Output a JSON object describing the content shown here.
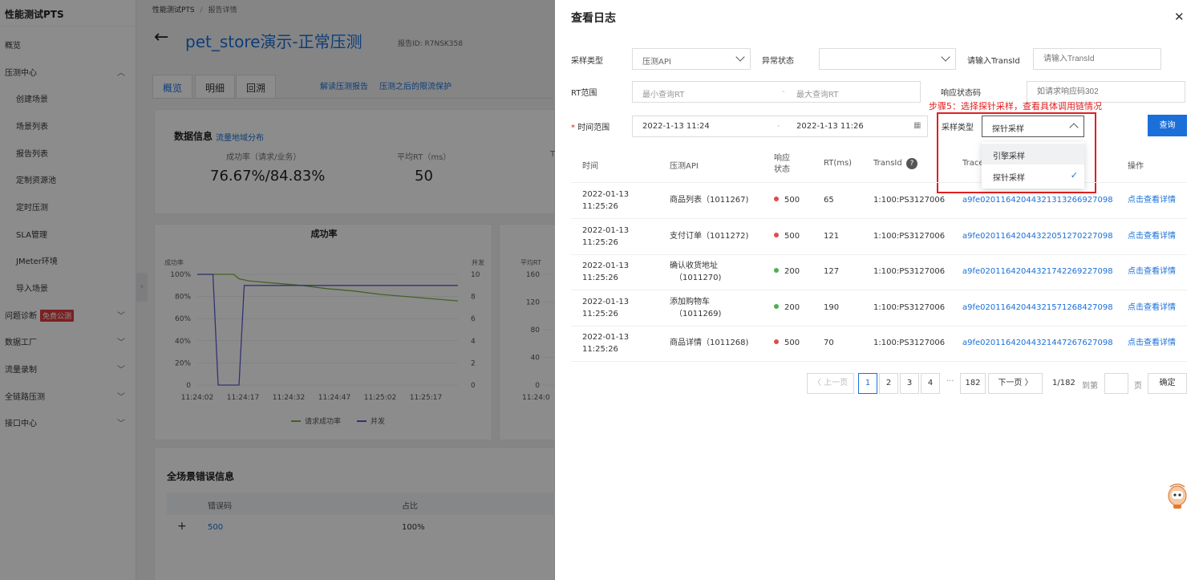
{
  "sidebar": {
    "brand": "性能测试PTS",
    "items": [
      {
        "label": "概览",
        "indent": false,
        "chev": ""
      },
      {
        "label": "压测中心",
        "indent": false,
        "chev": "︿"
      },
      {
        "label": "创建场景",
        "indent": true,
        "chev": ""
      },
      {
        "label": "场景列表",
        "indent": true,
        "chev": ""
      },
      {
        "label": "报告列表",
        "indent": true,
        "chev": ""
      },
      {
        "label": "定制资源池",
        "indent": true,
        "chev": ""
      },
      {
        "label": "定时压测",
        "indent": true,
        "chev": ""
      },
      {
        "label": "SLA管理",
        "indent": true,
        "chev": ""
      },
      {
        "label": "JMeter环境",
        "indent": true,
        "chev": ""
      },
      {
        "label": "导入场景",
        "indent": true,
        "chev": ""
      },
      {
        "label": "问题诊断",
        "indent": false,
        "chev": "﹀",
        "badge": "免费公测"
      },
      {
        "label": "数据工厂",
        "indent": false,
        "chev": "﹀"
      },
      {
        "label": "流量录制",
        "indent": false,
        "chev": "﹀"
      },
      {
        "label": "全链路压测",
        "indent": false,
        "chev": "﹀"
      },
      {
        "label": "接口中心",
        "indent": false,
        "chev": "﹀"
      }
    ]
  },
  "main": {
    "breadcrumb_root": "性能测试PTS",
    "breadcrumb_sep": "/",
    "breadcrumb_current": "报告详情",
    "back_arrow": "←",
    "title": "pet_store演示-正常压测",
    "report_id": "报告ID:  R7NSK358",
    "tabs": [
      "概览",
      "明细",
      "回溯"
    ],
    "links": [
      "解读压测报告",
      "压测之后的限流保护"
    ],
    "data_info_title": "数据信息",
    "data_info_link": "流量地域分布",
    "metrics": [
      {
        "label": "成功率（请求/业务）",
        "value": "76.67%/84.83%"
      },
      {
        "label": "平均RT（ms）",
        "value": "50"
      }
    ],
    "metric_clip": "T",
    "chart_title": "成功率",
    "error_title": "全场景错误信息",
    "error_cols": [
      "错误码",
      "占比"
    ],
    "error_row": {
      "expand": "+",
      "code": "500",
      "ratio": "100%"
    }
  },
  "chart_data": [
    {
      "type": "line",
      "title": "成功率",
      "x": [
        "11:24:02",
        "11:24:17",
        "11:24:32",
        "11:24:47",
        "11:25:02",
        "11:25:17"
      ],
      "left_axis_title": "成功率",
      "right_axis_title": "并发",
      "left_ticks": [
        "100%",
        "80%",
        "60%",
        "40%",
        "20%",
        "0"
      ],
      "right_ticks": [
        "10",
        "8",
        "6",
        "4",
        "2",
        "0"
      ],
      "ylim_left": [
        0,
        100
      ],
      "ylim_right": [
        0,
        10
      ],
      "series": [
        {
          "name": "请求成功率",
          "color": "#7cb342",
          "axis": "left",
          "points": [
            [
              0,
              100
            ],
            [
              14,
              100
            ],
            [
              16,
              96
            ],
            [
              20,
              94
            ],
            [
              30,
              92
            ],
            [
              40,
              90
            ],
            [
              50,
              87
            ],
            [
              60,
              85
            ],
            [
              70,
              82
            ],
            [
              80,
              80
            ],
            [
              90,
              78
            ],
            [
              100,
              76
            ]
          ]
        },
        {
          "name": "并发",
          "color": "#5b5bd6",
          "axis": "right",
          "points": [
            [
              0,
              10
            ],
            [
              6,
              10
            ],
            [
              8,
              0
            ],
            [
              16,
              0
            ],
            [
              18,
              9
            ],
            [
              100,
              9
            ]
          ]
        }
      ]
    },
    {
      "type": "line",
      "title": "",
      "x": [
        "11:24:0"
      ],
      "left_axis_title": "平均RT",
      "left_ticks": [
        "160",
        "120",
        "80",
        "40",
        "0"
      ],
      "series": []
    }
  ],
  "drawer": {
    "title": "查看日志",
    "close": "✕",
    "filters": {
      "sample_type_label": "采样类型",
      "sample_type_value": "压测API",
      "error_state_label": "异常状态",
      "error_state_value": "",
      "transid_label": "请输入TransId",
      "transid_placeholder": "请输入TransId",
      "rt_label": "RT范围",
      "rt_min_placeholder": "最小查询RT",
      "rt_dash": "-",
      "rt_max_placeholder": "最大查询RT",
      "status_label": "响应状态码",
      "status_placeholder": "如请求响应码302",
      "time_required": "*",
      "time_label": "时间范围",
      "time_start": "2022-1-13 11:24",
      "time_dash": "-",
      "time_end": "2022-1-13 11:26",
      "calendar": "▦",
      "sampling_label": "采样类型",
      "sampling_value": "探针采样",
      "query_button": "查询"
    },
    "annotation": "步骤5：选择探针采样，查看具体调用链情况",
    "dropdown_options": [
      {
        "label": "引擎采样",
        "selected": false
      },
      {
        "label": "探针采样",
        "selected": true
      }
    ],
    "checkmark": "✓",
    "table_headers": [
      "时间",
      "压测API",
      "响应状态",
      "RT(ms)",
      "TransId",
      "Trace",
      "操作"
    ],
    "help": "?",
    "rows": [
      {
        "date": "2022-01-13",
        "time": "11:25:26",
        "api": "商品列表（1011267)",
        "api2": "",
        "status": "500",
        "status_color": "#e5484d",
        "rt": "65",
        "transid": "1:100:PS3127006",
        "trace": "a9fe020116420443213132669270​98",
        "action": "点击查看详情"
      },
      {
        "date": "2022-01-13",
        "time": "11:25:26",
        "api": "支付订单（1011272)",
        "api2": "",
        "status": "500",
        "status_color": "#e5484d",
        "rt": "121",
        "transid": "1:100:PS3127006",
        "trace": "a9fe0201164204432205127022709​8",
        "action": "点击查看详情"
      },
      {
        "date": "2022-01-13",
        "time": "11:25:26",
        "api": "确认收货地址",
        "api2": "（1011270)",
        "status": "200",
        "status_color": "#4caf50",
        "rt": "127",
        "transid": "1:100:PS3127006",
        "trace": "a9fe0201164204432174226922709​8",
        "action": "点击查看详情"
      },
      {
        "date": "2022-01-13",
        "time": "11:25:26",
        "api": "添加购物车",
        "api2": "（1011269)",
        "status": "200",
        "status_color": "#4caf50",
        "rt": "190",
        "transid": "1:100:PS3127006",
        "trace": "a9fe0201164204432157126842709​8",
        "action": "点击查看详情"
      },
      {
        "date": "2022-01-13",
        "time": "11:25:26",
        "api": "商品详情（1011268)",
        "api2": "",
        "status": "500",
        "status_color": "#e5484d",
        "rt": "70",
        "transid": "1:100:PS3127006",
        "trace": "a9fe0201164204432144726762709​8",
        "action": "点击查看详情"
      }
    ],
    "pagination": {
      "prev": "〈 上一页",
      "pages": [
        "1",
        "2",
        "3",
        "4"
      ],
      "ellipsis": "···",
      "last": "182",
      "next": "下一页 〉",
      "total": "1/182",
      "goto": "到第",
      "page_unit": "页",
      "confirm": "确定"
    }
  }
}
